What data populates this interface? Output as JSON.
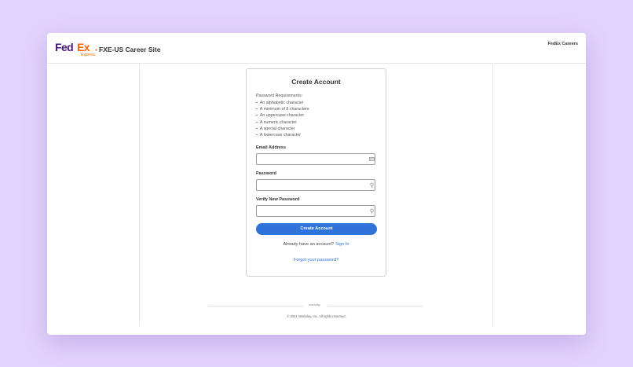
{
  "header": {
    "logo_fed": "Fed",
    "logo_ex": "Ex",
    "logo_sub": "Express",
    "site_title": "FXE-US Career Site",
    "careers_link": "FedEx Careers"
  },
  "form": {
    "title": "Create Account",
    "requirements_title": "Password Requirements:",
    "requirements": [
      "An alphabetic character",
      "A minimum of 8 characters",
      "An uppercase character",
      "A numeric character",
      "A special character",
      "A lowercase character"
    ],
    "email_label": "Email Address",
    "email_value": "",
    "password_label": "Password",
    "password_value": "",
    "verify_label": "Verify New Password",
    "verify_value": "",
    "submit_label": "Create Account",
    "already_text": "Already have an account?",
    "signin_label": "Sign In",
    "forgot_label": "Forgot your password?"
  },
  "footer": {
    "logo_text": "workday.",
    "copyright": "© 2021 Workday, Inc. All rights reserved."
  },
  "colors": {
    "background": "#e2d3fb",
    "fedex_purple": "#4d148c",
    "fedex_orange": "#ff6600",
    "primary_button": "#2f73d9"
  },
  "icons": {
    "email_field": "contact-card-icon",
    "password_field": "key-icon",
    "verify_field": "key-icon"
  }
}
